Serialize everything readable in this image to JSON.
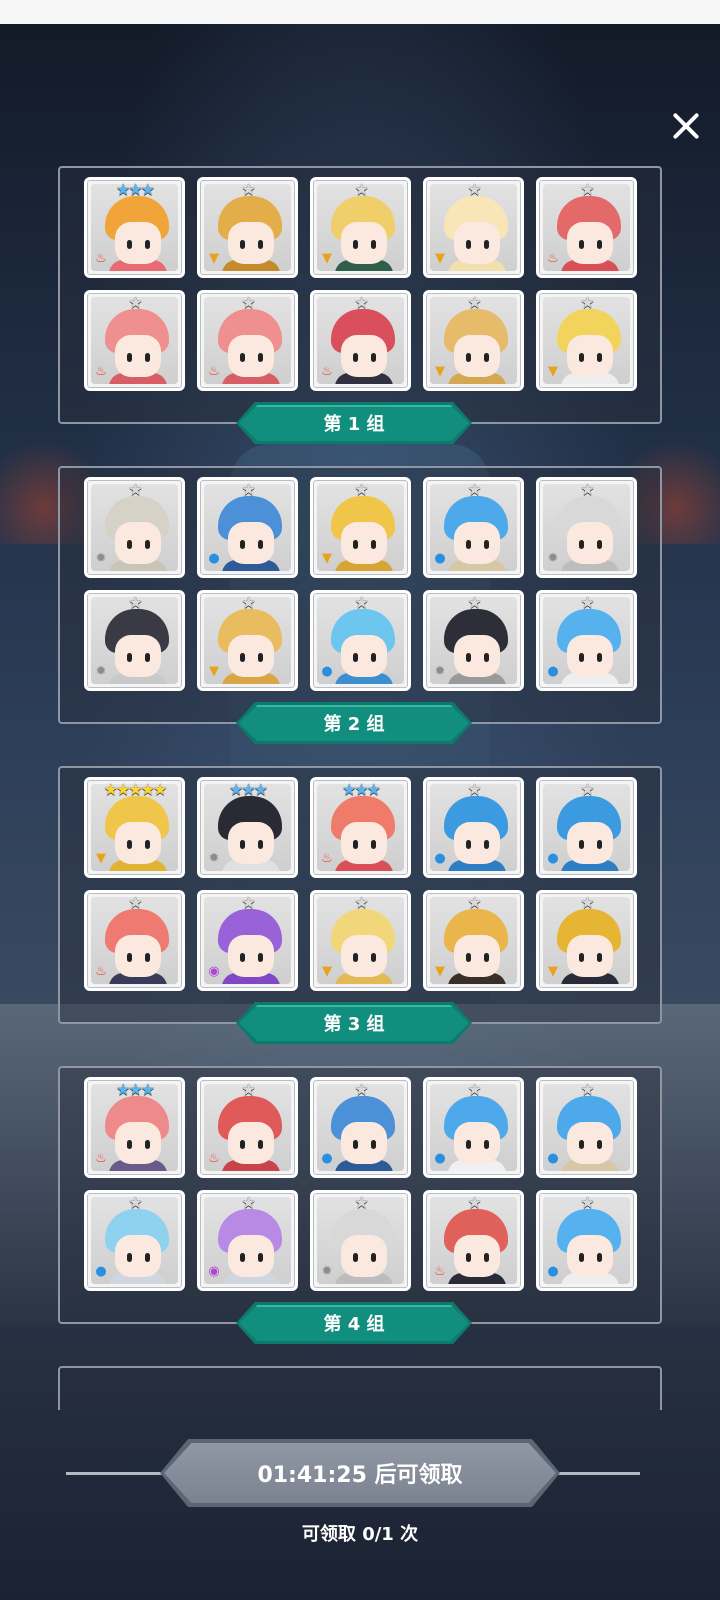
{
  "close_icon": "close-icon",
  "groups": [
    {
      "label": "第 1 组",
      "cards": [
        {
          "stars": "★★★",
          "tier": 3,
          "element": "fire",
          "hair": "#f0a43a",
          "body": "#e86b74"
        },
        {
          "stars": "★",
          "tier": 1,
          "element": "earth",
          "hair": "#e3ad4a",
          "body": "#c58a2e"
        },
        {
          "stars": "★",
          "tier": 1,
          "element": "earth",
          "hair": "#f0cf6a",
          "body": "#2f5f4a"
        },
        {
          "stars": "★",
          "tier": 1,
          "element": "earth",
          "hair": "#f8e6b8",
          "body": "#f2dfae"
        },
        {
          "stars": "★",
          "tier": 1,
          "element": "fire",
          "hair": "#e46a6a",
          "body": "#d84f55"
        },
        {
          "stars": "★",
          "tier": 1,
          "element": "fire",
          "hair": "#ef8f8f",
          "body": "#d65e64"
        },
        {
          "stars": "★",
          "tier": 1,
          "element": "fire",
          "hair": "#ef8f8f",
          "body": "#d65e64"
        },
        {
          "stars": "★",
          "tier": 1,
          "element": "fire",
          "hair": "#d94f5c",
          "body": "#303040"
        },
        {
          "stars": "★",
          "tier": 1,
          "element": "earth",
          "hair": "#e6bc6b",
          "body": "#d4a853"
        },
        {
          "stars": "★",
          "tier": 1,
          "element": "earth",
          "hair": "#f2d45c",
          "body": "#eeeeee"
        }
      ]
    },
    {
      "label": "第 2 组",
      "cards": [
        {
          "stars": "★",
          "tier": 1,
          "element": "gear",
          "hair": "#d6d2c8",
          "body": "#c9c4b8"
        },
        {
          "stars": "★",
          "tier": 1,
          "element": "water",
          "hair": "#4c90d8",
          "body": "#2e5a98"
        },
        {
          "stars": "★",
          "tier": 1,
          "element": "earth",
          "hair": "#f0c64a",
          "body": "#d6a535"
        },
        {
          "stars": "★",
          "tier": 1,
          "element": "water",
          "hair": "#4ea9ea",
          "body": "#d8c7a6"
        },
        {
          "stars": "★",
          "tier": 1,
          "element": "gear",
          "hair": "#d8d8d8",
          "body": "#bdbdbd"
        },
        {
          "stars": "★",
          "tier": 1,
          "element": "gear",
          "hair": "#3a3a44",
          "body": "#c9c9c9"
        },
        {
          "stars": "★",
          "tier": 1,
          "element": "earth",
          "hair": "#e9bc5f",
          "body": "#d9a647"
        },
        {
          "stars": "★",
          "tier": 1,
          "element": "water",
          "hair": "#6cc6ef",
          "body": "#3e8fd0"
        },
        {
          "stars": "★",
          "tier": 1,
          "element": "gear",
          "hair": "#2e2e38",
          "body": "#9a9a9a"
        },
        {
          "stars": "★",
          "tier": 1,
          "element": "water",
          "hair": "#56b2ee",
          "body": "#eeeeee"
        }
      ]
    },
    {
      "label": "第 3 组",
      "cards": [
        {
          "stars": "★★★★★",
          "tier": 5,
          "element": "earth",
          "hair": "#f0c64a",
          "body": "#e2b233"
        },
        {
          "stars": "★★★",
          "tier": 3,
          "element": "gear",
          "hair": "#2a2a34",
          "body": "#e0e0e0"
        },
        {
          "stars": "★★★",
          "tier": 3,
          "element": "fire",
          "hair": "#ef7b6b",
          "body": "#d84f55"
        },
        {
          "stars": "★",
          "tier": 1,
          "element": "water",
          "hair": "#3c9be0",
          "body": "#2e7ec4"
        },
        {
          "stars": "★",
          "tier": 1,
          "element": "water",
          "hair": "#3c9be0",
          "body": "#2e7ec4"
        },
        {
          "stars": "★",
          "tier": 1,
          "element": "fire",
          "hair": "#ef7a72",
          "body": "#3a3a5a"
        },
        {
          "stars": "★",
          "tier": 1,
          "element": "dark",
          "hair": "#9a62d8",
          "body": "#8048c2"
        },
        {
          "stars": "★",
          "tier": 1,
          "element": "earth",
          "hair": "#f2d77a",
          "body": "#e3b955"
        },
        {
          "stars": "★",
          "tier": 1,
          "element": "earth",
          "hair": "#eab54a",
          "body": "#3a2e28"
        },
        {
          "stars": "★",
          "tier": 1,
          "element": "earth",
          "hair": "#e7b534",
          "body": "#2a2a38"
        }
      ]
    },
    {
      "label": "第 4 组",
      "cards": [
        {
          "stars": "★★★",
          "tier": 3,
          "element": "fire",
          "hair": "#ef8a8a",
          "body": "#6a5a8a"
        },
        {
          "stars": "★",
          "tier": 1,
          "element": "fire",
          "hair": "#e05a5a",
          "body": "#c9444a"
        },
        {
          "stars": "★",
          "tier": 1,
          "element": "water",
          "hair": "#4c90d8",
          "body": "#2e5a98"
        },
        {
          "stars": "★",
          "tier": 1,
          "element": "water",
          "hair": "#4ea9ea",
          "body": "#f0f0f0"
        },
        {
          "stars": "★",
          "tier": 1,
          "element": "water",
          "hair": "#4ea9ea",
          "body": "#d8c7a6"
        },
        {
          "stars": "★",
          "tier": 1,
          "element": "water",
          "hair": "#8fd2f0",
          "body": "#cfd6e0"
        },
        {
          "stars": "★",
          "tier": 1,
          "element": "dark",
          "hair": "#b88ae6",
          "body": "#cfd6e0"
        },
        {
          "stars": "★",
          "tier": 1,
          "element": "gear",
          "hair": "#d8d8d8",
          "body": "#bdbdbd"
        },
        {
          "stars": "★",
          "tier": 1,
          "element": "fire",
          "hair": "#e0605a",
          "body": "#2a2a38"
        },
        {
          "stars": "★",
          "tier": 1,
          "element": "water",
          "hair": "#56b2ee",
          "body": "#eeeeee"
        }
      ]
    }
  ],
  "element_icons": {
    "fire": {
      "icon": "fire-icon",
      "glyph": "♨"
    },
    "earth": {
      "icon": "earth-icon",
      "glyph": "▼"
    },
    "water": {
      "icon": "water-icon",
      "glyph": "●"
    },
    "gear": {
      "icon": "gear-icon",
      "glyph": "✹"
    },
    "dark": {
      "icon": "dark-icon",
      "glyph": "◉"
    }
  },
  "footer": {
    "claim_label": "01:41:25 后可领取",
    "claim_count": "可领取 0/1 次"
  }
}
